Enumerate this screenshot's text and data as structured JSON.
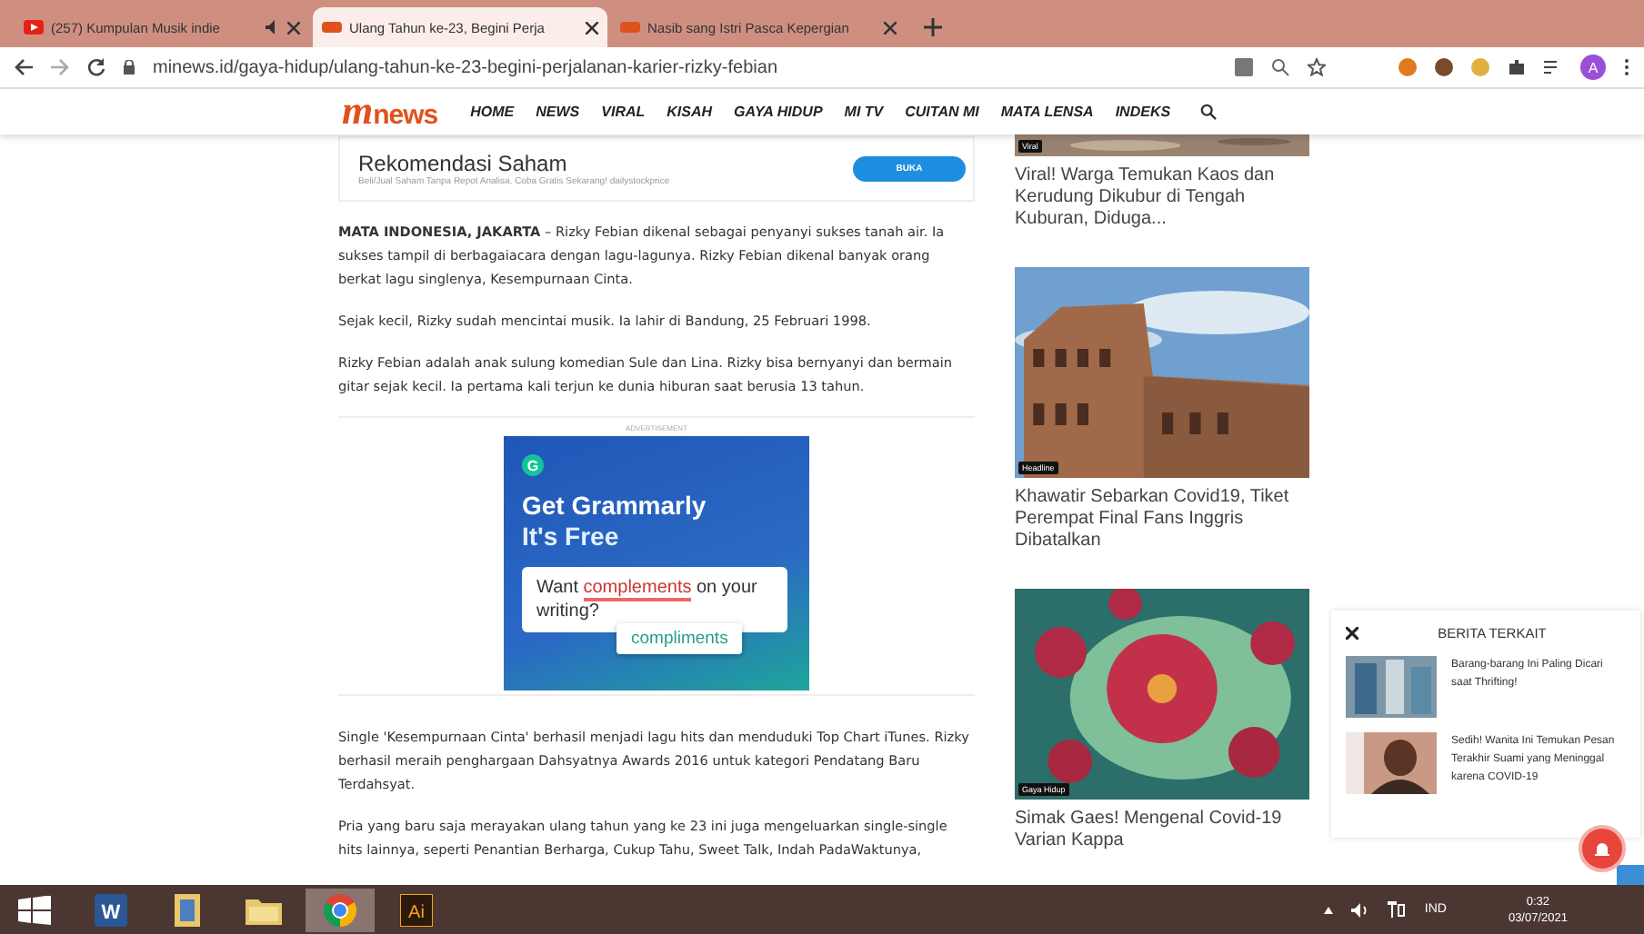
{
  "browser": {
    "tabs": [
      {
        "title": "(257) Kumpulan Musik indie",
        "selected": false,
        "audio": true,
        "kind": "video"
      },
      {
        "title": "Ulang Tahun ke-23, Begini Perja",
        "selected": true,
        "audio": false,
        "kind": "site"
      },
      {
        "title": "Nasib sang Istri Pasca Kepergian",
        "selected": false,
        "audio": false,
        "kind": "site"
      }
    ],
    "url": "minews.id/gaya-hidup/ulang-tahun-ke-23-begini-perjalanan-karier-rizky-febian",
    "profile": "A"
  },
  "site": {
    "logo": {
      "mark": "m",
      "word": "news"
    },
    "nav": [
      "HOME",
      "NEWS",
      "VIRAL",
      "KISAH",
      "GAYA HIDUP",
      "MI TV",
      "CUITAN MI",
      "MATA LENSA",
      "INDEKS"
    ]
  },
  "promo": {
    "title": "Rekomendasi Saham",
    "subtitle": "Beli/Jual Saham Tanpa Repot Analisa. Coba Gratis Sekarang! dailystockprice",
    "button": "BUKA"
  },
  "paragraphs_top": [
    "**MATA INDONESIA, JAKARTA** – Rizky Febian dikenal sebagai penyanyi sukses tanah air. Ia sukses tampil di berbagaiacara dengan lagu-lagunya. Rizky Febian dikenal banyak orang berkat lagu singlenya, Kesempurnaan Cinta.",
    "Sejak kecil, Rizky sudah mencintai musik. Ia lahir di Bandung, 25 Februari 1998.",
    "Rizky Febian adalah anak sulung komedian Sule dan Lina. Rizky bisa bernyanyi dan bermain gitar sejak kecil. Ia pertama kali terjun ke dunia hiburan saat berusia 13 tahun."
  ],
  "advert": {
    "label": "ADVERTISEMENT",
    "brand": "G",
    "headline": "Get Grammarly",
    "subline": "It's Free",
    "prompt_start": "Want ",
    "prompt_word": "complements",
    "prompt_end": " on your writing?",
    "suggestion": "compliments"
  },
  "paragraphs_bottom": [
    "Single 'Kesempurnaan Cinta' berhasil menjadi lagu hits dan menduduki Top Chart iTunes. Rizky berhasil meraih penghargaan Dahsyatnya Awards 2016 untuk kategori Pendatang Baru Terdahsyat.",
    "Pria yang baru saja merayakan ulang tahun yang ke 23 ini juga mengeluarkan single-single hits lainnya, seperti Penantian Berharga, Cukup Tahu, Sweet Talk, Indah PadaWaktunya,"
  ],
  "sidebar": [
    {
      "tag": "Viral",
      "title": "Viral! Warga Temukan Kaos dan Kerudung Dikubur di Tengah Kuburan, Diduga...",
      "kind": "ground"
    },
    {
      "tag": "Headline",
      "title": "Khawatir Sebarkan Covid19, Tiket Perempat Final Fans Inggris Dibatalkan",
      "kind": "colosseum"
    },
    {
      "tag": "Gaya Hidup",
      "title": "Simak Gaes! Mengenal Covid-19 Varian Kappa",
      "kind": "virus"
    }
  ],
  "related": {
    "heading": "BERITA TERKAIT",
    "items": [
      {
        "title": "Barang-barang Ini Paling Dicari saat Thrifting!",
        "kind": "market"
      },
      {
        "title": "Sedih! Wanita Ini Temukan Pesan Terakhir Suami yang Meninggal karena COVID-19",
        "kind": "woman"
      }
    ]
  },
  "taskbar": {
    "apps": [
      {
        "kind": "word",
        "label": "W",
        "active": false
      },
      {
        "kind": "docs",
        "active": false
      },
      {
        "kind": "folder",
        "active": false
      },
      {
        "kind": "chrome",
        "active": true
      },
      {
        "kind": "illustrator",
        "label": "Ai",
        "active": false
      }
    ],
    "language": "IND",
    "time": "0:32",
    "date": "03/07/2021"
  }
}
